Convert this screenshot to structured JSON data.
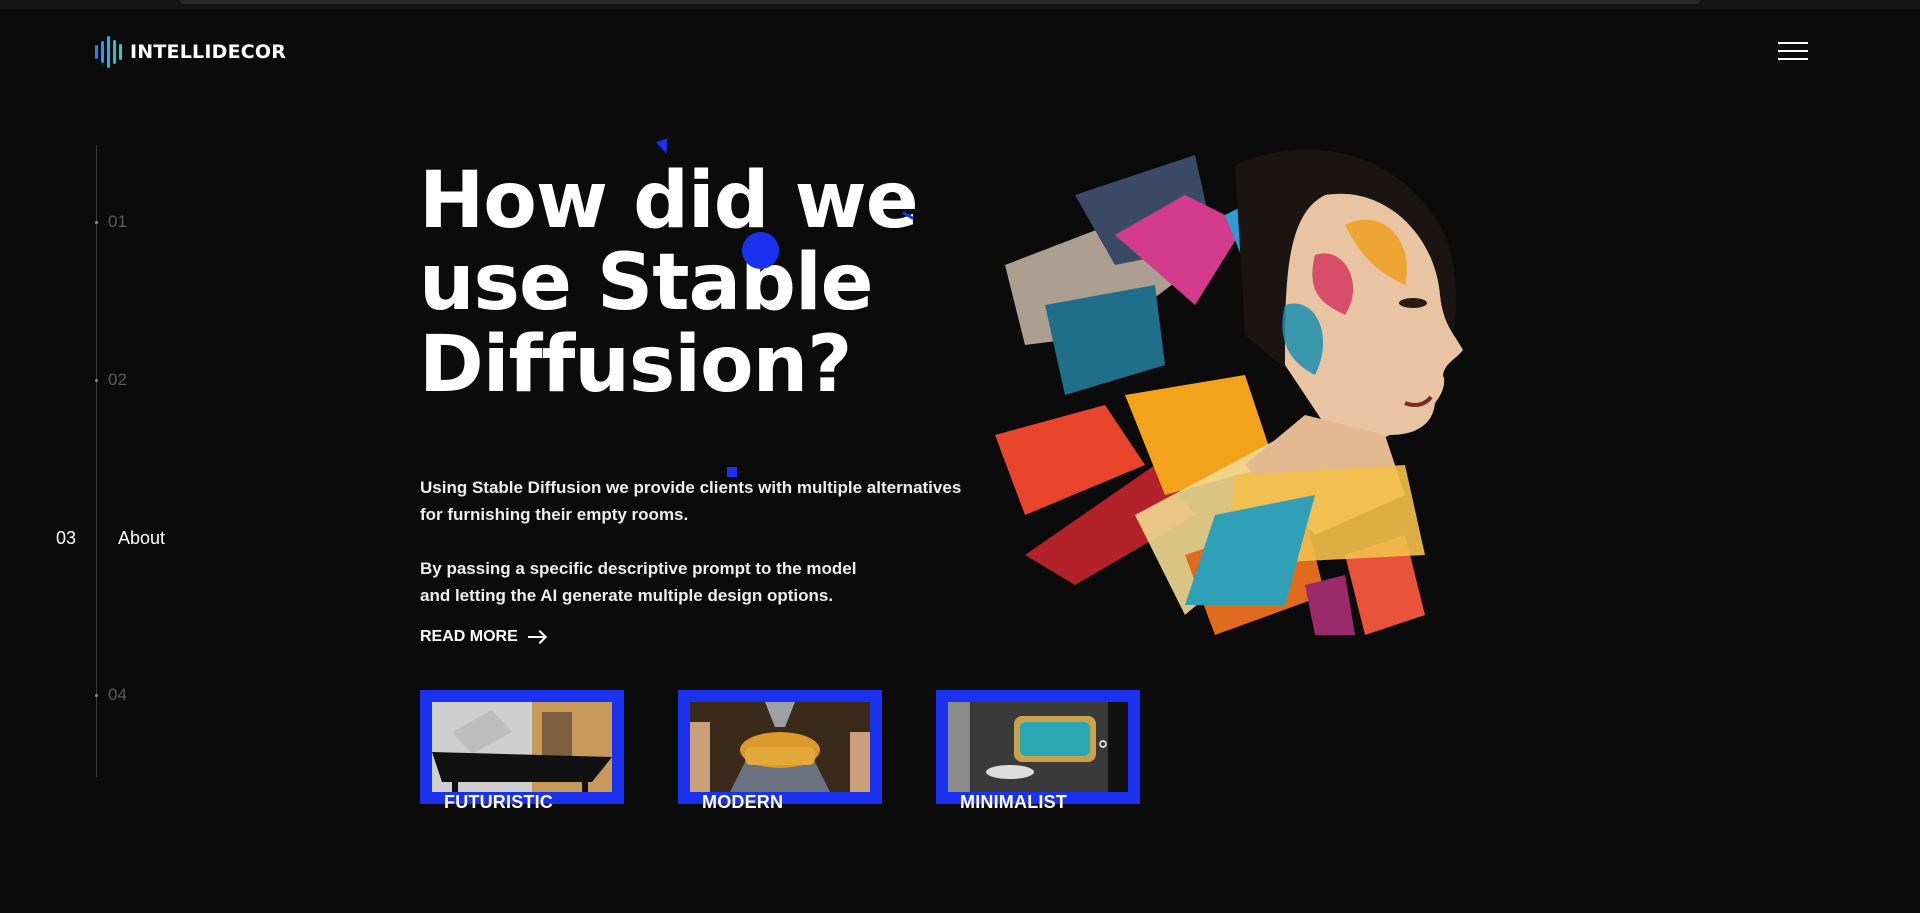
{
  "brand": {
    "name": "INTELLIDECOR",
    "accent": "#1a32f0",
    "logo_gradient": [
      "#2b7bff",
      "#1fd1c8"
    ]
  },
  "header": {
    "menu_icon": "hamburger-icon"
  },
  "nav": {
    "items": [
      {
        "num": "01",
        "label": ""
      },
      {
        "num": "02",
        "label": ""
      },
      {
        "num": "03",
        "label": "About",
        "active": true
      },
      {
        "num": "04",
        "label": ""
      }
    ]
  },
  "hero": {
    "headline_lines": [
      "How did we",
      "use Stable",
      "Diffusion?"
    ],
    "paragraph1_lines": [
      "Using Stable Diffusion we provide clients with multiple alternatives",
      "for furnishing their empty rooms."
    ],
    "paragraph2_lines": [
      "By passing a specific descriptive prompt to the model",
      "and letting the AI generate multiple design options."
    ],
    "read_more": "READ MORE",
    "read_more_icon": "arrow-right-icon"
  },
  "styles": [
    {
      "label": "FUTURISTIC"
    },
    {
      "label": "MODERN"
    },
    {
      "label": "MINIMALIST"
    }
  ],
  "art": {
    "subject": "abstract-painted-woman-portrait"
  }
}
